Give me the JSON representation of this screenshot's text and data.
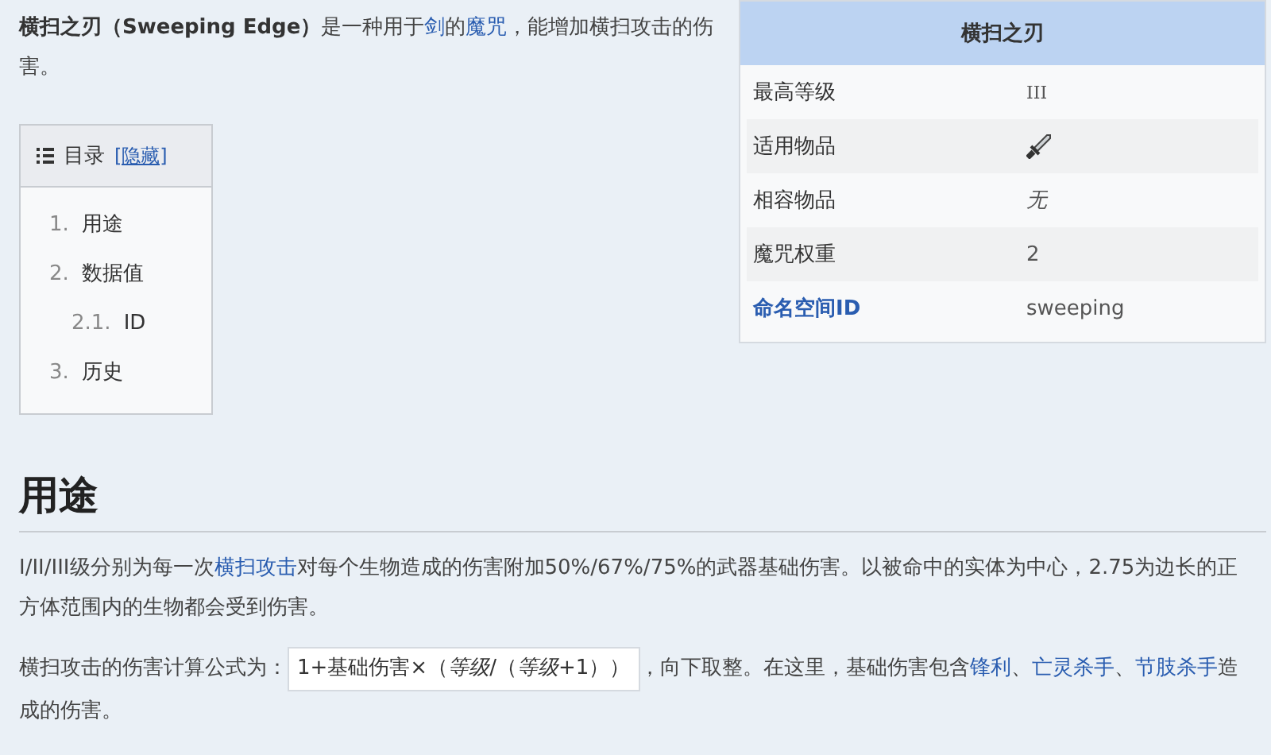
{
  "intro": [
    {
      "kind": "bold",
      "text": "横扫之刃（Sweeping Edge）"
    },
    {
      "kind": "text",
      "text": "是一种用于"
    },
    {
      "kind": "link",
      "text": "剑"
    },
    {
      "kind": "text",
      "text": "的"
    },
    {
      "kind": "link",
      "text": "魔咒"
    },
    {
      "kind": "text",
      "text": "，能增加横扫攻击的伤害。"
    }
  ],
  "toc": {
    "title": "目录",
    "toggle": "[隐藏]",
    "items": [
      {
        "number": "1.",
        "label": "用途"
      },
      {
        "number": "2.",
        "label": "数据值",
        "children": [
          {
            "number": "2.1.",
            "label": "ID"
          }
        ]
      },
      {
        "number": "3.",
        "label": "历史"
      }
    ]
  },
  "infobox": {
    "title": "横扫之刃",
    "rows": [
      {
        "label": "最高等级",
        "label_link": false,
        "kind": "roman",
        "value": "III"
      },
      {
        "label": "适用物品",
        "label_link": false,
        "kind": "icon"
      },
      {
        "label": "相容物品",
        "label_link": false,
        "kind": "italic",
        "value": "无"
      },
      {
        "label": "魔咒权重",
        "label_link": false,
        "kind": "text",
        "value": "2"
      },
      {
        "label": "命名空间ID",
        "label_link": true,
        "kind": "text",
        "value": "sweeping"
      }
    ]
  },
  "section": {
    "heading": "用途",
    "paragraphs": [
      [
        {
          "kind": "text",
          "text": "I/II/III级分别为每一次"
        },
        {
          "kind": "link",
          "text": "横扫攻击"
        },
        {
          "kind": "text",
          "text": "对每个生物造成的伤害附加50%/67%/75%的武器基础伤害。以被命中的实体为中心，2.75为边长的正方体范围内的生物都会受到伤害。"
        }
      ],
      [
        {
          "kind": "text",
          "text": "横扫攻击的伤害计算公式为："
        },
        {
          "kind": "formula",
          "text": "1+基础伤害×（*等级*/（*等级*+1））"
        },
        {
          "kind": "text",
          "text": "，向下取整。在这里，基础伤害包含"
        },
        {
          "kind": "link",
          "text": "锋利"
        },
        {
          "kind": "text",
          "text": "、"
        },
        {
          "kind": "link",
          "text": "亡灵杀手"
        },
        {
          "kind": "text",
          "text": "、"
        },
        {
          "kind": "link",
          "text": "节肢杀手"
        },
        {
          "kind": "text",
          "text": "造成的伤害。"
        }
      ]
    ]
  }
}
